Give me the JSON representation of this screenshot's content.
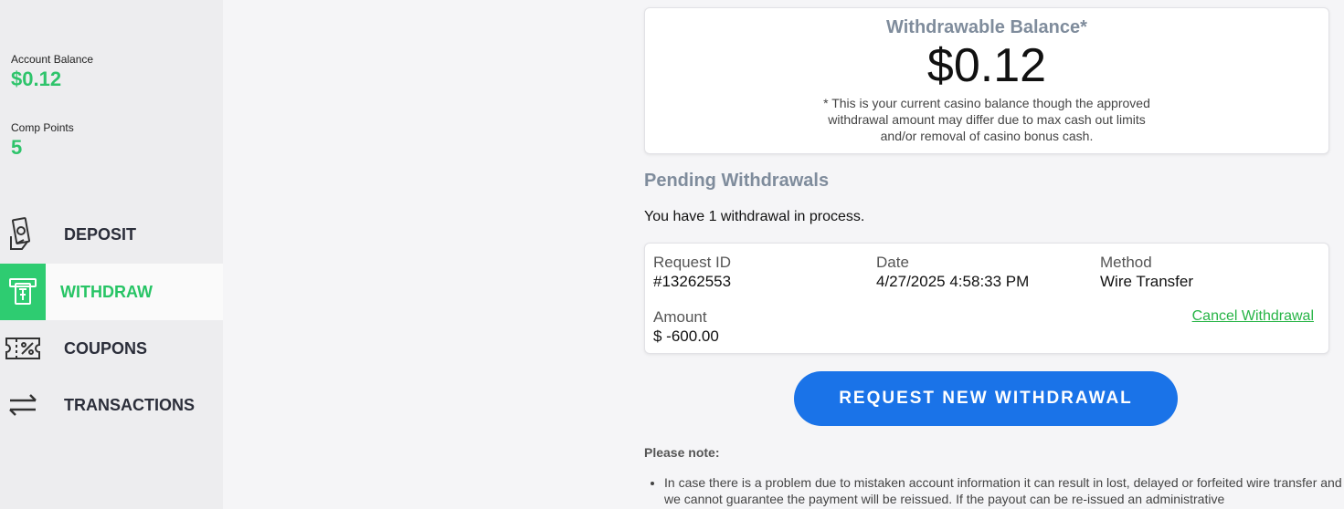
{
  "sidebar": {
    "account_balance_label": "Account Balance",
    "account_balance_value": "$0.12",
    "comp_points_label": "Comp Points",
    "comp_points_value": "5",
    "nav": [
      {
        "label": "DEPOSIT",
        "icon": "cash-hand-icon"
      },
      {
        "label": "WITHDRAW",
        "icon": "atm-icon",
        "active": true
      },
      {
        "label": "COUPONS",
        "icon": "coupon-icon"
      },
      {
        "label": "TRANSACTIONS",
        "icon": "arrows-exchange-icon"
      }
    ]
  },
  "balance": {
    "title": "Withdrawable Balance*",
    "amount": "$0.12",
    "note": "* This is your current casino balance though the approved withdrawal amount may differ due to max cash out limits and/or removal of casino bonus cash."
  },
  "pending": {
    "title": "Pending Withdrawals",
    "summary": "You have 1 withdrawal in process.",
    "request": {
      "id_label": "Request ID",
      "id_value": "#13262553",
      "date_label": "Date",
      "date_value": "4/27/2025 4:58:33 PM",
      "method_label": "Method",
      "method_value": "Wire Transfer",
      "amount_label": "Amount",
      "amount_value": "$ -600.00",
      "cancel_label": "Cancel Withdrawal"
    }
  },
  "request_button_label": "REQUEST NEW WITHDRAWAL",
  "notes": {
    "title": "Please note:",
    "items": [
      "In case there is a problem due to mistaken account information it can result in lost, delayed or forfeited wire transfer and we cannot guarantee the payment will be reissued. If the payout can be re-issued an administrative"
    ]
  },
  "colors": {
    "accent_green": "#2ecc71",
    "primary_blue": "#1a73e8",
    "heading_gray": "#7f8c9c"
  }
}
